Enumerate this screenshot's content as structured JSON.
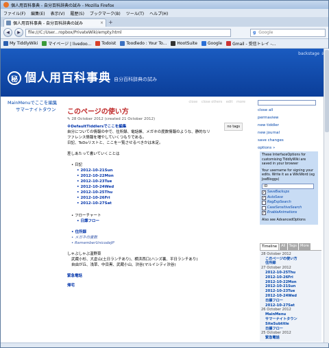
{
  "window": {
    "title": "個人用百科事典 - 自分百科辞典の試み - Mozilla Firefox"
  },
  "menu": [
    "ファイル(F)",
    "編集(E)",
    "表示(V)",
    "履歴(S)",
    "ブックマーク(B)",
    "ツール(T)",
    "ヘルプ(H)"
  ],
  "tab": {
    "label": "個人用百科事典 - 自分百科辞典の試み"
  },
  "nav": {
    "url": "file:///C:/User...ropbox/PrivateWiki/empty.html",
    "search_placeholder": "Google"
  },
  "bookmarks": [
    {
      "label": "My TiddlyWiki",
      "color": "#2b5fb0"
    },
    {
      "label": "マイページ | livedoo...",
      "color": "#3a9a3a"
    },
    {
      "label": "Todoist",
      "color": "#d8402a"
    },
    {
      "label": "Toodledo : Your To...",
      "color": "#3a6fc0"
    },
    {
      "label": "HootSuite",
      "color": "#333"
    },
    {
      "label": "Google",
      "color": "#2a6fd6"
    },
    {
      "label": "Gmail - 受信トレイ -...",
      "color": "#c33"
    }
  ],
  "header": {
    "backstage": "backstage ⇓",
    "seal": "秘",
    "site_title": "個人用百科事典",
    "subtitle": "自分百科辞典の試み"
  },
  "mainmenu": [
    "MainMenuでここを編集",
    "サマーナイトタウン"
  ],
  "tiddler": {
    "toolbar": [
      "close",
      "close others",
      "edit",
      "more"
    ],
    "title": "このページの使い方",
    "subinfo": "28 October 2012 (created 21 October 2012)",
    "tags_button": "no tags",
    "edit_note": "※DefaultTiddlersでここを編集",
    "intro": [
      "自分についての情報の中で、住所録、電話帳、メガネの度数情報のような、静的なリ",
      "ファレンス情報を増やしていくつもりである。",
      "日記、ToDoリストと、ここを一覧させるべきかは未定。"
    ],
    "lead": "差しあたって書いていくことは",
    "diary_label": "日記",
    "diary": [
      "2012-10-21Sun",
      "2012-10-22Mon",
      "2012-10-23Tue",
      "2012-10-24Wed",
      "2012-10-25Thu",
      "2012-10-26Fri",
      "2012-10-27Sat"
    ],
    "flow_label": "フローチャート",
    "flow": "日課フロー",
    "misc": [
      "住所録",
      "メガネの度数",
      "RememberUnicodeJP"
    ],
    "spa_title": "しゃぶしゃぶ温野菜",
    "spa_text": [
      "武蔵小杉、大倉山(土日ランチあり)、横浜西口(ハンズ裏、平日ランチあり)",
      "自由が丘、浅草、中目黒、武蔵小山、渋谷(マルイシティ渋谷)"
    ],
    "emergency": "緊急電話",
    "return": "帰宅"
  },
  "sidebar": {
    "search": "search",
    "links": [
      "close all",
      "permaview",
      "new tiddler",
      "new journal",
      "save changes",
      "options »"
    ],
    "options_text": "These InterfaceOptions for customising TiddlyWiki are saved in your browser",
    "username_text": "Your username for signing your edits. Write it as a WikiWord (eg JoeBloggs)",
    "username": "ID",
    "checks": [
      {
        "label": "SaveBackups",
        "checked": true
      },
      {
        "label": "AutoSave",
        "checked": true
      },
      {
        "label": "RegExpSearch",
        "checked": false
      },
      {
        "label": "CaseSensitiveSearch",
        "checked": false
      },
      {
        "label": "EnableAnimations",
        "checked": true
      }
    ],
    "advanced": "Also see AdvancedOptions"
  },
  "timeline": {
    "tabs": [
      "Timeline",
      "All",
      "Tags",
      "More"
    ],
    "entries": [
      {
        "date": "28 October 2012",
        "items": [
          "このページの使い方",
          "住所録"
        ]
      },
      {
        "date": "27 October 2012",
        "items": [
          "2012-10-25Thu",
          "2012-10-26Fri",
          "2012-10-22Mon",
          "2012-10-21Sun",
          "2012-10-23Tue",
          "2012-10-24Wed",
          "日課フロー",
          "2012-10-27Sat"
        ]
      },
      {
        "date": "26 October 2012",
        "items": [
          "MainMenu",
          "サマーナイトタウン",
          "SiteSubtitle",
          "日課フロー"
        ]
      },
      {
        "date": "25 October 2012",
        "items": [
          "緊急電話"
        ]
      }
    ]
  }
}
